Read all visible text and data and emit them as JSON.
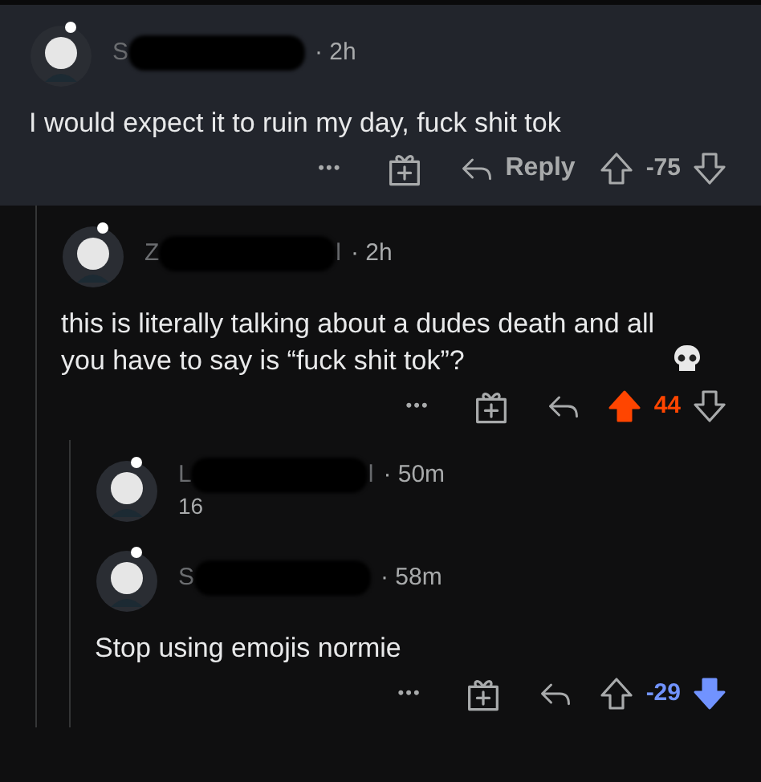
{
  "comments": [
    {
      "name_start": "S",
      "time": "· 2h",
      "highlighted": true,
      "body": "I would expect it to ruin my day, fuck shit tok",
      "more": "•••",
      "reply_label": "Reply",
      "score": "-75",
      "upvoted": false,
      "downvoted": false,
      "children": [
        {
          "name_start": "Z",
          "name_end": "l",
          "time": "· 2h",
          "highlighted": false,
          "body": "this is literally talking about a dudes death and all you have to say is “fuck shit tok”?",
          "skull": true,
          "more": "•••",
          "score": "44",
          "upvoted": true,
          "downvoted": false,
          "children": [
            {
              "name_start": "L",
              "name_end": "l",
              "time": "· 50m",
              "flair": "16",
              "highlighted": false
            },
            {
              "name_start": "S",
              "time": "· 58m",
              "highlighted": false,
              "body": "Stop using emojis normie",
              "more": "•••",
              "score": "-29",
              "upvoted": false,
              "downvoted": true
            }
          ]
        }
      ]
    }
  ]
}
